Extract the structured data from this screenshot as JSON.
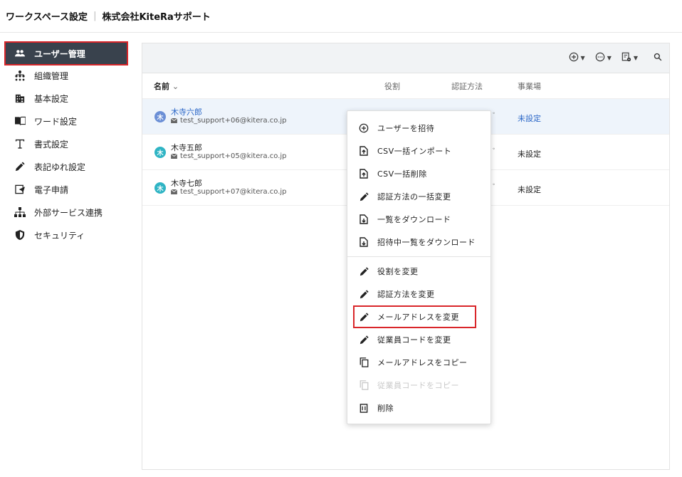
{
  "header": {
    "workspace_label": "ワークスペース設定",
    "separator": "|",
    "company": "株式会社KiteRaサポート"
  },
  "sidebar": {
    "items": [
      {
        "label": "ユーザー管理",
        "icon": "users-icon",
        "active": true
      },
      {
        "label": "組織管理",
        "icon": "org-tree-icon"
      },
      {
        "label": "基本設定",
        "icon": "building-icon"
      },
      {
        "label": "ワード設定",
        "icon": "book-icon"
      },
      {
        "label": "書式設定",
        "icon": "text-format-icon"
      },
      {
        "label": "表記ゆれ設定",
        "icon": "pencil-icon"
      },
      {
        "label": "電子申請",
        "icon": "e-application-icon"
      },
      {
        "label": "外部サービス連携",
        "icon": "sitemap-icon"
      },
      {
        "label": "セキュリティ",
        "icon": "shield-icon"
      }
    ]
  },
  "toolbar": {
    "buttons": [
      "add-circle-icon",
      "more-circle-icon",
      "export-settings-icon",
      "search-icon"
    ]
  },
  "table": {
    "columns": {
      "name": "名前",
      "role": "役割",
      "auth": "認証方法",
      "site": "事業場"
    },
    "rows": [
      {
        "name": "木寺六郎",
        "email": "test_support+06@kitera.co.jp",
        "avatar": "木",
        "site": "未設定",
        "peek": "ﾞ"
      },
      {
        "name": "木寺五郎",
        "email": "test_support+05@kitera.co.jp",
        "avatar": "木",
        "site": "未設定",
        "peek": "ﾞ"
      },
      {
        "name": "木寺七郎",
        "email": "test_support+07@kitera.co.jp",
        "avatar": "木",
        "site": "未設定",
        "peek": "ﾞ"
      }
    ]
  },
  "menu": {
    "group1": [
      {
        "label": "ユーザーを招待",
        "icon": "add-circle-icon"
      },
      {
        "label": "CSV一括インポート",
        "icon": "file-upload-icon"
      },
      {
        "label": "CSV一括削除",
        "icon": "file-upload-icon"
      },
      {
        "label": "認証方法の一括変更",
        "icon": "pencil-icon"
      },
      {
        "label": "一覧をダウンロード",
        "icon": "file-download-icon"
      },
      {
        "label": "招待中一覧をダウンロード",
        "icon": "file-download-icon"
      }
    ],
    "group2": [
      {
        "label": "役割を変更",
        "icon": "pencil-icon"
      },
      {
        "label": "認証方法を変更",
        "icon": "pencil-icon"
      },
      {
        "label": "メールアドレスを変更",
        "icon": "pencil-icon",
        "highlighted": true
      },
      {
        "label": "従業員コードを変更",
        "icon": "pencil-icon"
      },
      {
        "label": "メールアドレスをコピー",
        "icon": "copy-icon"
      },
      {
        "label": "従業員コードをコピー",
        "icon": "copy-icon",
        "disabled": true
      },
      {
        "label": "削除",
        "icon": "trash-icon"
      }
    ]
  },
  "colors": {
    "sidebar_active_bg": "#39424d",
    "highlight_border": "#d9262a",
    "link_blue": "#2b67c7",
    "selected_row_bg": "#eef4fb"
  }
}
